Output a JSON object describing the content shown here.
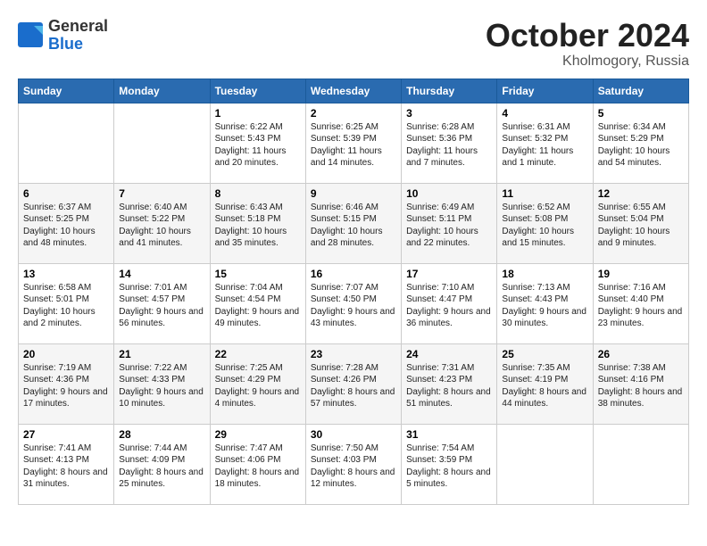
{
  "header": {
    "logo_general": "General",
    "logo_blue": "Blue",
    "month": "October 2024",
    "location": "Kholmogory, Russia"
  },
  "weekdays": [
    "Sunday",
    "Monday",
    "Tuesday",
    "Wednesday",
    "Thursday",
    "Friday",
    "Saturday"
  ],
  "weeks": [
    [
      {
        "day": "",
        "sunrise": "",
        "sunset": "",
        "daylight": ""
      },
      {
        "day": "",
        "sunrise": "",
        "sunset": "",
        "daylight": ""
      },
      {
        "day": "1",
        "sunrise": "Sunrise: 6:22 AM",
        "sunset": "Sunset: 5:43 PM",
        "daylight": "Daylight: 11 hours and 20 minutes."
      },
      {
        "day": "2",
        "sunrise": "Sunrise: 6:25 AM",
        "sunset": "Sunset: 5:39 PM",
        "daylight": "Daylight: 11 hours and 14 minutes."
      },
      {
        "day": "3",
        "sunrise": "Sunrise: 6:28 AM",
        "sunset": "Sunset: 5:36 PM",
        "daylight": "Daylight: 11 hours and 7 minutes."
      },
      {
        "day": "4",
        "sunrise": "Sunrise: 6:31 AM",
        "sunset": "Sunset: 5:32 PM",
        "daylight": "Daylight: 11 hours and 1 minute."
      },
      {
        "day": "5",
        "sunrise": "Sunrise: 6:34 AM",
        "sunset": "Sunset: 5:29 PM",
        "daylight": "Daylight: 10 hours and 54 minutes."
      }
    ],
    [
      {
        "day": "6",
        "sunrise": "Sunrise: 6:37 AM",
        "sunset": "Sunset: 5:25 PM",
        "daylight": "Daylight: 10 hours and 48 minutes."
      },
      {
        "day": "7",
        "sunrise": "Sunrise: 6:40 AM",
        "sunset": "Sunset: 5:22 PM",
        "daylight": "Daylight: 10 hours and 41 minutes."
      },
      {
        "day": "8",
        "sunrise": "Sunrise: 6:43 AM",
        "sunset": "Sunset: 5:18 PM",
        "daylight": "Daylight: 10 hours and 35 minutes."
      },
      {
        "day": "9",
        "sunrise": "Sunrise: 6:46 AM",
        "sunset": "Sunset: 5:15 PM",
        "daylight": "Daylight: 10 hours and 28 minutes."
      },
      {
        "day": "10",
        "sunrise": "Sunrise: 6:49 AM",
        "sunset": "Sunset: 5:11 PM",
        "daylight": "Daylight: 10 hours and 22 minutes."
      },
      {
        "day": "11",
        "sunrise": "Sunrise: 6:52 AM",
        "sunset": "Sunset: 5:08 PM",
        "daylight": "Daylight: 10 hours and 15 minutes."
      },
      {
        "day": "12",
        "sunrise": "Sunrise: 6:55 AM",
        "sunset": "Sunset: 5:04 PM",
        "daylight": "Daylight: 10 hours and 9 minutes."
      }
    ],
    [
      {
        "day": "13",
        "sunrise": "Sunrise: 6:58 AM",
        "sunset": "Sunset: 5:01 PM",
        "daylight": "Daylight: 10 hours and 2 minutes."
      },
      {
        "day": "14",
        "sunrise": "Sunrise: 7:01 AM",
        "sunset": "Sunset: 4:57 PM",
        "daylight": "Daylight: 9 hours and 56 minutes."
      },
      {
        "day": "15",
        "sunrise": "Sunrise: 7:04 AM",
        "sunset": "Sunset: 4:54 PM",
        "daylight": "Daylight: 9 hours and 49 minutes."
      },
      {
        "day": "16",
        "sunrise": "Sunrise: 7:07 AM",
        "sunset": "Sunset: 4:50 PM",
        "daylight": "Daylight: 9 hours and 43 minutes."
      },
      {
        "day": "17",
        "sunrise": "Sunrise: 7:10 AM",
        "sunset": "Sunset: 4:47 PM",
        "daylight": "Daylight: 9 hours and 36 minutes."
      },
      {
        "day": "18",
        "sunrise": "Sunrise: 7:13 AM",
        "sunset": "Sunset: 4:43 PM",
        "daylight": "Daylight: 9 hours and 30 minutes."
      },
      {
        "day": "19",
        "sunrise": "Sunrise: 7:16 AM",
        "sunset": "Sunset: 4:40 PM",
        "daylight": "Daylight: 9 hours and 23 minutes."
      }
    ],
    [
      {
        "day": "20",
        "sunrise": "Sunrise: 7:19 AM",
        "sunset": "Sunset: 4:36 PM",
        "daylight": "Daylight: 9 hours and 17 minutes."
      },
      {
        "day": "21",
        "sunrise": "Sunrise: 7:22 AM",
        "sunset": "Sunset: 4:33 PM",
        "daylight": "Daylight: 9 hours and 10 minutes."
      },
      {
        "day": "22",
        "sunrise": "Sunrise: 7:25 AM",
        "sunset": "Sunset: 4:29 PM",
        "daylight": "Daylight: 9 hours and 4 minutes."
      },
      {
        "day": "23",
        "sunrise": "Sunrise: 7:28 AM",
        "sunset": "Sunset: 4:26 PM",
        "daylight": "Daylight: 8 hours and 57 minutes."
      },
      {
        "day": "24",
        "sunrise": "Sunrise: 7:31 AM",
        "sunset": "Sunset: 4:23 PM",
        "daylight": "Daylight: 8 hours and 51 minutes."
      },
      {
        "day": "25",
        "sunrise": "Sunrise: 7:35 AM",
        "sunset": "Sunset: 4:19 PM",
        "daylight": "Daylight: 8 hours and 44 minutes."
      },
      {
        "day": "26",
        "sunrise": "Sunrise: 7:38 AM",
        "sunset": "Sunset: 4:16 PM",
        "daylight": "Daylight: 8 hours and 38 minutes."
      }
    ],
    [
      {
        "day": "27",
        "sunrise": "Sunrise: 7:41 AM",
        "sunset": "Sunset: 4:13 PM",
        "daylight": "Daylight: 8 hours and 31 minutes."
      },
      {
        "day": "28",
        "sunrise": "Sunrise: 7:44 AM",
        "sunset": "Sunset: 4:09 PM",
        "daylight": "Daylight: 8 hours and 25 minutes."
      },
      {
        "day": "29",
        "sunrise": "Sunrise: 7:47 AM",
        "sunset": "Sunset: 4:06 PM",
        "daylight": "Daylight: 8 hours and 18 minutes."
      },
      {
        "day": "30",
        "sunrise": "Sunrise: 7:50 AM",
        "sunset": "Sunset: 4:03 PM",
        "daylight": "Daylight: 8 hours and 12 minutes."
      },
      {
        "day": "31",
        "sunrise": "Sunrise: 7:54 AM",
        "sunset": "Sunset: 3:59 PM",
        "daylight": "Daylight: 8 hours and 5 minutes."
      },
      {
        "day": "",
        "sunrise": "",
        "sunset": "",
        "daylight": ""
      },
      {
        "day": "",
        "sunrise": "",
        "sunset": "",
        "daylight": ""
      }
    ]
  ]
}
